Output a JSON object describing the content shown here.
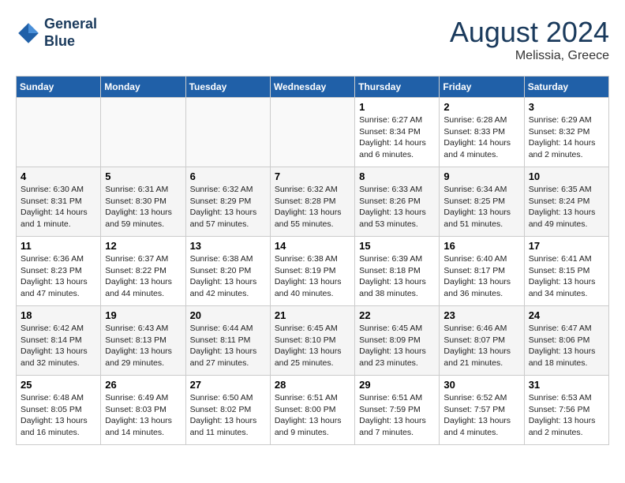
{
  "header": {
    "logo_line1": "General",
    "logo_line2": "Blue",
    "month_year": "August 2024",
    "location": "Melissia, Greece"
  },
  "days_of_week": [
    "Sunday",
    "Monday",
    "Tuesday",
    "Wednesday",
    "Thursday",
    "Friday",
    "Saturday"
  ],
  "weeks": [
    [
      {
        "day": "",
        "info": ""
      },
      {
        "day": "",
        "info": ""
      },
      {
        "day": "",
        "info": ""
      },
      {
        "day": "",
        "info": ""
      },
      {
        "day": "1",
        "info": "Sunrise: 6:27 AM\nSunset: 8:34 PM\nDaylight: 14 hours\nand 6 minutes."
      },
      {
        "day": "2",
        "info": "Sunrise: 6:28 AM\nSunset: 8:33 PM\nDaylight: 14 hours\nand 4 minutes."
      },
      {
        "day": "3",
        "info": "Sunrise: 6:29 AM\nSunset: 8:32 PM\nDaylight: 14 hours\nand 2 minutes."
      }
    ],
    [
      {
        "day": "4",
        "info": "Sunrise: 6:30 AM\nSunset: 8:31 PM\nDaylight: 14 hours\nand 1 minute."
      },
      {
        "day": "5",
        "info": "Sunrise: 6:31 AM\nSunset: 8:30 PM\nDaylight: 13 hours\nand 59 minutes."
      },
      {
        "day": "6",
        "info": "Sunrise: 6:32 AM\nSunset: 8:29 PM\nDaylight: 13 hours\nand 57 minutes."
      },
      {
        "day": "7",
        "info": "Sunrise: 6:32 AM\nSunset: 8:28 PM\nDaylight: 13 hours\nand 55 minutes."
      },
      {
        "day": "8",
        "info": "Sunrise: 6:33 AM\nSunset: 8:26 PM\nDaylight: 13 hours\nand 53 minutes."
      },
      {
        "day": "9",
        "info": "Sunrise: 6:34 AM\nSunset: 8:25 PM\nDaylight: 13 hours\nand 51 minutes."
      },
      {
        "day": "10",
        "info": "Sunrise: 6:35 AM\nSunset: 8:24 PM\nDaylight: 13 hours\nand 49 minutes."
      }
    ],
    [
      {
        "day": "11",
        "info": "Sunrise: 6:36 AM\nSunset: 8:23 PM\nDaylight: 13 hours\nand 47 minutes."
      },
      {
        "day": "12",
        "info": "Sunrise: 6:37 AM\nSunset: 8:22 PM\nDaylight: 13 hours\nand 44 minutes."
      },
      {
        "day": "13",
        "info": "Sunrise: 6:38 AM\nSunset: 8:20 PM\nDaylight: 13 hours\nand 42 minutes."
      },
      {
        "day": "14",
        "info": "Sunrise: 6:38 AM\nSunset: 8:19 PM\nDaylight: 13 hours\nand 40 minutes."
      },
      {
        "day": "15",
        "info": "Sunrise: 6:39 AM\nSunset: 8:18 PM\nDaylight: 13 hours\nand 38 minutes."
      },
      {
        "day": "16",
        "info": "Sunrise: 6:40 AM\nSunset: 8:17 PM\nDaylight: 13 hours\nand 36 minutes."
      },
      {
        "day": "17",
        "info": "Sunrise: 6:41 AM\nSunset: 8:15 PM\nDaylight: 13 hours\nand 34 minutes."
      }
    ],
    [
      {
        "day": "18",
        "info": "Sunrise: 6:42 AM\nSunset: 8:14 PM\nDaylight: 13 hours\nand 32 minutes."
      },
      {
        "day": "19",
        "info": "Sunrise: 6:43 AM\nSunset: 8:13 PM\nDaylight: 13 hours\nand 29 minutes."
      },
      {
        "day": "20",
        "info": "Sunrise: 6:44 AM\nSunset: 8:11 PM\nDaylight: 13 hours\nand 27 minutes."
      },
      {
        "day": "21",
        "info": "Sunrise: 6:45 AM\nSunset: 8:10 PM\nDaylight: 13 hours\nand 25 minutes."
      },
      {
        "day": "22",
        "info": "Sunrise: 6:45 AM\nSunset: 8:09 PM\nDaylight: 13 hours\nand 23 minutes."
      },
      {
        "day": "23",
        "info": "Sunrise: 6:46 AM\nSunset: 8:07 PM\nDaylight: 13 hours\nand 21 minutes."
      },
      {
        "day": "24",
        "info": "Sunrise: 6:47 AM\nSunset: 8:06 PM\nDaylight: 13 hours\nand 18 minutes."
      }
    ],
    [
      {
        "day": "25",
        "info": "Sunrise: 6:48 AM\nSunset: 8:05 PM\nDaylight: 13 hours\nand 16 minutes."
      },
      {
        "day": "26",
        "info": "Sunrise: 6:49 AM\nSunset: 8:03 PM\nDaylight: 13 hours\nand 14 minutes."
      },
      {
        "day": "27",
        "info": "Sunrise: 6:50 AM\nSunset: 8:02 PM\nDaylight: 13 hours\nand 11 minutes."
      },
      {
        "day": "28",
        "info": "Sunrise: 6:51 AM\nSunset: 8:00 PM\nDaylight: 13 hours\nand 9 minutes."
      },
      {
        "day": "29",
        "info": "Sunrise: 6:51 AM\nSunset: 7:59 PM\nDaylight: 13 hours\nand 7 minutes."
      },
      {
        "day": "30",
        "info": "Sunrise: 6:52 AM\nSunset: 7:57 PM\nDaylight: 13 hours\nand 4 minutes."
      },
      {
        "day": "31",
        "info": "Sunrise: 6:53 AM\nSunset: 7:56 PM\nDaylight: 13 hours\nand 2 minutes."
      }
    ]
  ]
}
